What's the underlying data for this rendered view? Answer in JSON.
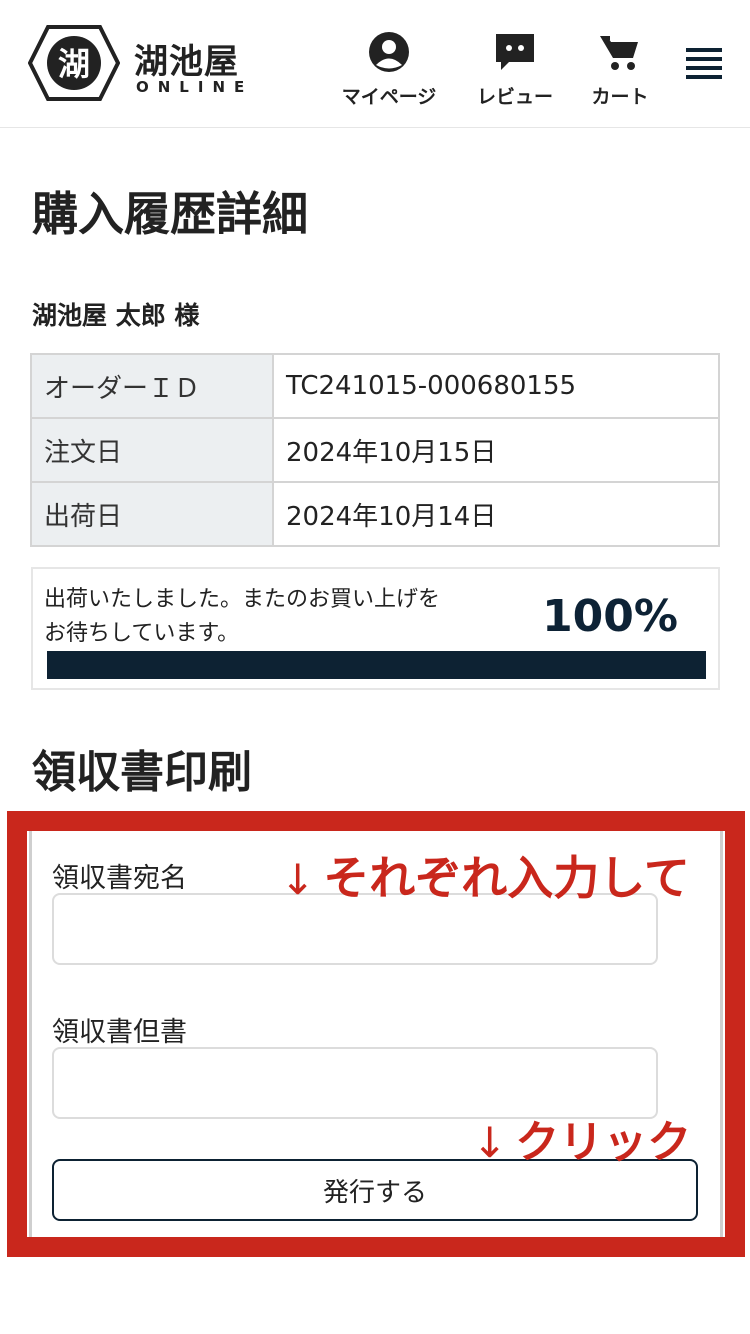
{
  "header": {
    "logo_char": "湖",
    "logo_name": "湖池屋",
    "logo_sub": "ONLINE",
    "nav": {
      "mypage": "マイページ",
      "review": "レビュー",
      "cart": "カート"
    }
  },
  "page": {
    "title": "購入履歴詳細",
    "customer": "湖池屋 太郎 様"
  },
  "order_info": {
    "rows": [
      {
        "label": "オーダーＩＤ",
        "value": "TC241015-000680155"
      },
      {
        "label": "注文日",
        "value": "2024年10月15日"
      },
      {
        "label": "出荷日",
        "value": "2024年10月14日"
      }
    ]
  },
  "status": {
    "message_line1": "出荷いたしました。またのお買い上げを",
    "message_line2": "お待ちしています。",
    "percent_label": "100%",
    "progress": 1.0
  },
  "receipt": {
    "title": "領収書印刷",
    "addressee_label": "領収書宛名",
    "addressee_value": "",
    "note_label": "領収書但書",
    "note_value": "",
    "issue_button": "発行する"
  },
  "annotations": {
    "enter_each": "それぞれ入力して",
    "click": "クリック",
    "arrow": "↓"
  },
  "colors": {
    "accent_red": "#c9271c",
    "navy": "#0d2233"
  }
}
